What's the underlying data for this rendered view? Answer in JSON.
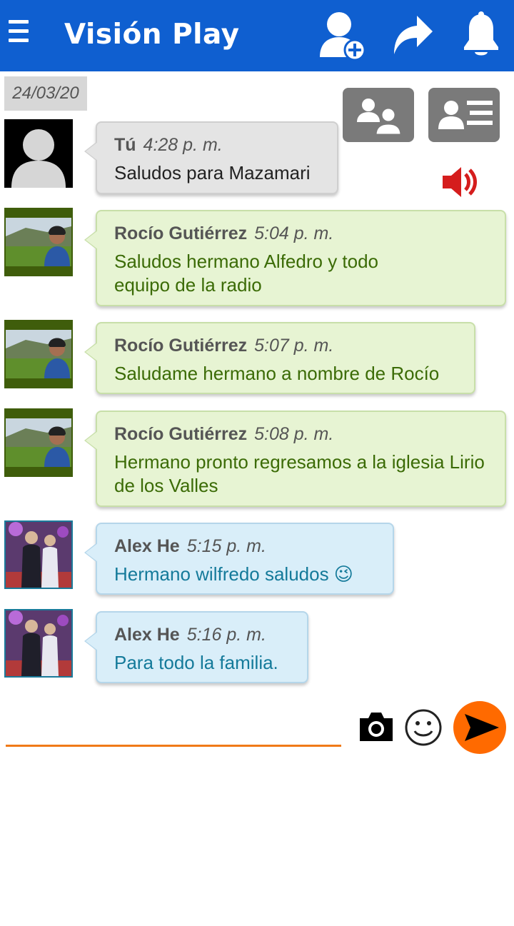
{
  "app": {
    "title": "Visión Play"
  },
  "header": {
    "icons": [
      "menu-icon",
      "add-user-icon",
      "share-icon",
      "bell-icon"
    ]
  },
  "chat": {
    "date": "24/03/20",
    "messages": [
      {
        "sender": "Tú",
        "time": "4:28 p. m.",
        "text": "Saludos para Mazamari",
        "style": "gray"
      },
      {
        "sender": "Rocío Gutiérrez",
        "time": "5:04 p. m.",
        "text": "Saludos hermano Alfedro y todo equipo de la radio",
        "style": "green"
      },
      {
        "sender": "Rocío Gutiérrez",
        "time": "5:07 p. m.",
        "text": "Saludame hermano a nombre de Rocío",
        "style": "green"
      },
      {
        "sender": "Rocío Gutiérrez",
        "time": "5:08 p. m.",
        "text": "Hermano pronto regresamos a la iglesia Lirio de los Valles",
        "style": "green"
      },
      {
        "sender": "Alex He",
        "time": "5:15 p. m.",
        "text": "Hermano wilfredo saludos 😉",
        "style": "blue"
      },
      {
        "sender": "Alex He",
        "time": "5:16 p. m.",
        "text": "Para todo la familia.",
        "style": "blue"
      }
    ]
  },
  "composer": {
    "value": "",
    "placeholder": ""
  },
  "colors": {
    "header": "#0f5fd0",
    "accent": "#f07a18",
    "send": "#ff6a00"
  }
}
